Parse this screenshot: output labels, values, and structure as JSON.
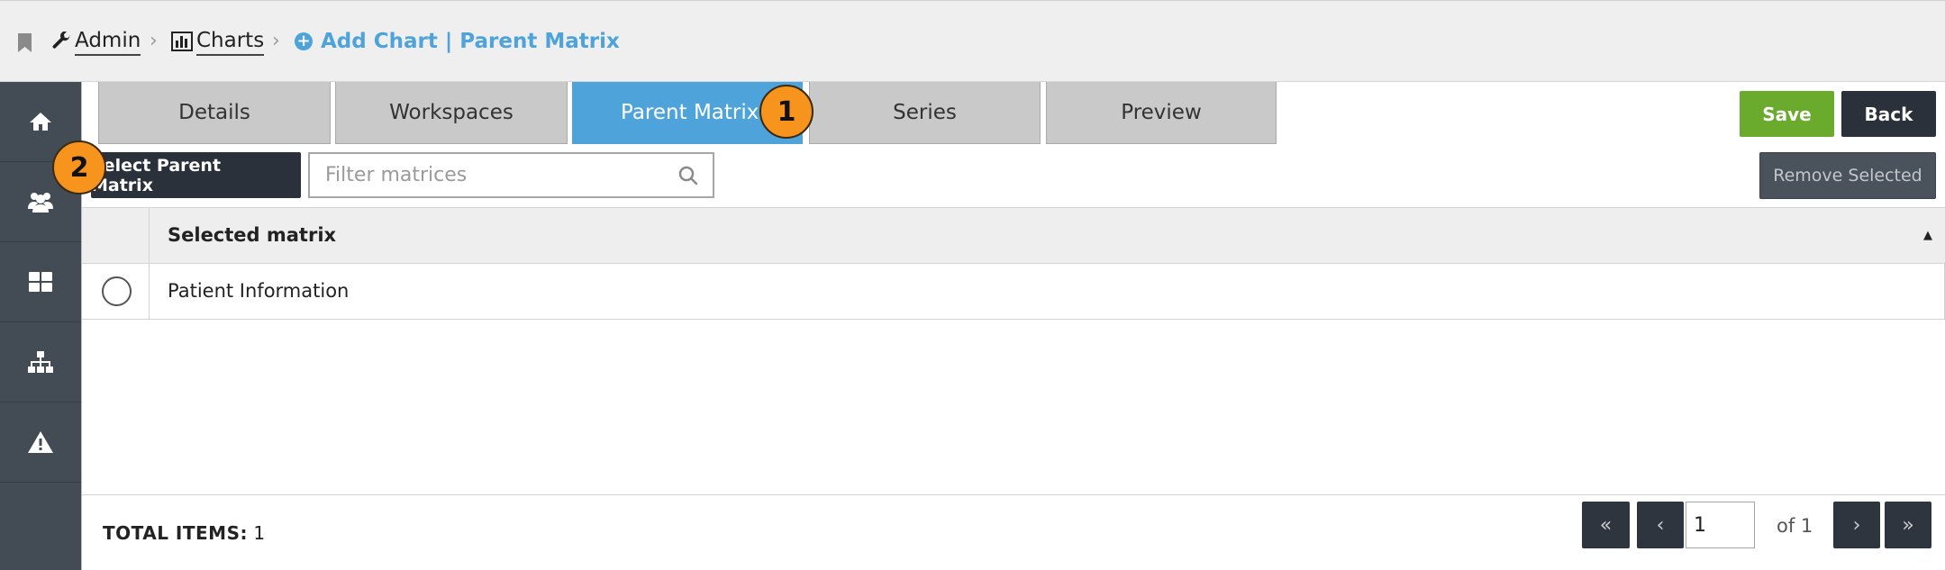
{
  "breadcrumb": {
    "items": [
      {
        "label": "Admin",
        "icon": "wrench-icon"
      },
      {
        "label": "Charts",
        "icon": "bar-chart-icon"
      }
    ],
    "separator": "›",
    "current": {
      "label": "Add Chart | Parent Matrix",
      "icon": "plus-circle-icon"
    }
  },
  "sidebar": {
    "items": [
      {
        "icon": "home-icon"
      },
      {
        "icon": "users-icon"
      },
      {
        "icon": "grid-icon"
      },
      {
        "icon": "sitemap-icon"
      },
      {
        "icon": "warning-icon"
      }
    ]
  },
  "tabs": [
    {
      "label": "Details"
    },
    {
      "label": "Workspaces"
    },
    {
      "label": "Parent Matrix",
      "active": true
    },
    {
      "label": "Series"
    },
    {
      "label": "Preview"
    }
  ],
  "actions": {
    "save_label": "Save",
    "back_label": "Back"
  },
  "toolbar": {
    "select_label": "Select Parent Matrix",
    "filter_placeholder": "Filter matrices",
    "filter_value": "",
    "remove_label": "Remove Selected"
  },
  "table": {
    "column_header": "Selected matrix",
    "sort_indicator": "▲",
    "rows": [
      {
        "name": "Patient Information",
        "selected": false
      }
    ]
  },
  "footer": {
    "total_label": "TOTAL ITEMS:",
    "total_value": "1",
    "page_value": "1",
    "of_text": "of 1",
    "first_symbol": "«",
    "prev_symbol": "‹",
    "next_symbol": "›",
    "last_symbol": "»"
  },
  "annotations": [
    "1",
    "2"
  ],
  "colors": {
    "accent": "#4ea3db",
    "save": "#6aab2e",
    "dark_button": "#2b313a",
    "sidebar": "#434b54",
    "badge": "#f7941d"
  }
}
